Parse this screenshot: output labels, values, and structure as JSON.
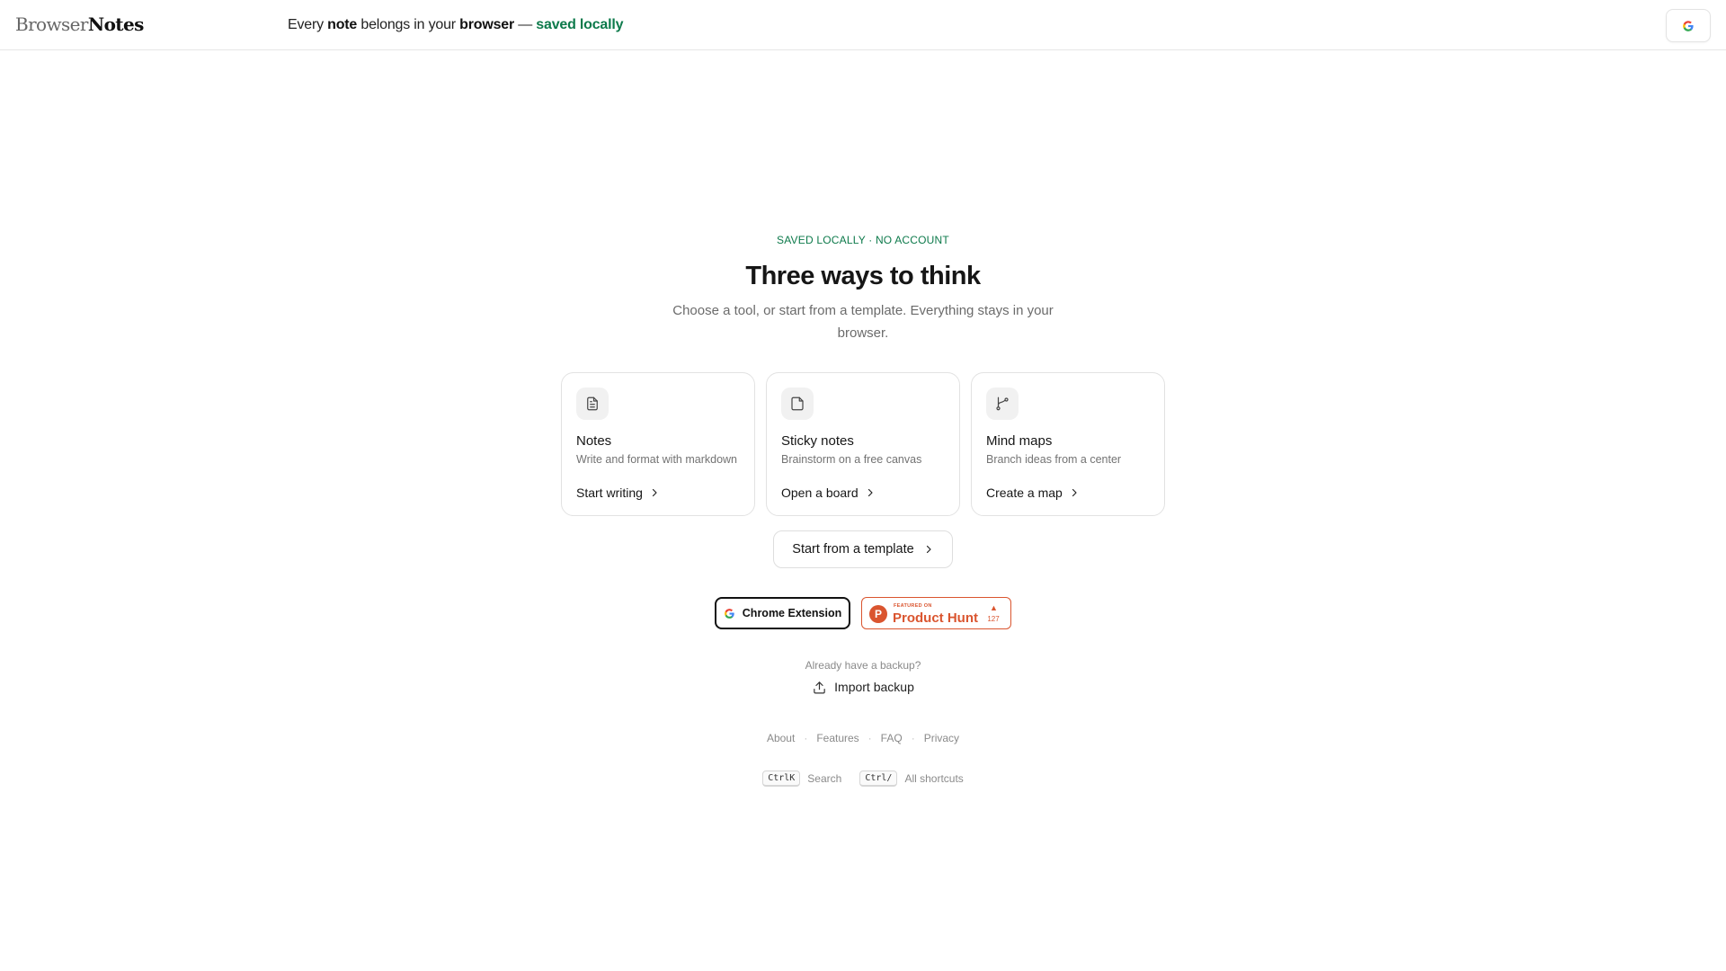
{
  "header": {
    "logo_light": "Browser",
    "logo_bold": "Notes",
    "tagline": {
      "t1": "Every ",
      "b1": "note",
      "t2": " belongs in your ",
      "b2": "browser",
      "t3": " — ",
      "green": "saved locally"
    },
    "google_icon": "google-g-icon"
  },
  "hero": {
    "eyebrow": "SAVED LOCALLY · NO ACCOUNT",
    "title": "Three ways to think",
    "subtitle": "Choose a tool, or start from a template. Everything stays in your browser."
  },
  "cards": [
    {
      "icon": "document-icon",
      "title": "Notes",
      "desc": "Write and format with markdown",
      "action": "Start writing"
    },
    {
      "icon": "sticky-note-icon",
      "title": "Sticky notes",
      "desc": "Brainstorm on a free canvas",
      "action": "Open a board"
    },
    {
      "icon": "branch-icon",
      "title": "Mind maps",
      "desc": "Branch ideas from a center",
      "action": "Create a map"
    }
  ],
  "template_button": "Start from a template",
  "badges": {
    "chrome": "Chrome Extension",
    "ph_small": "FEATURED ON",
    "ph_name": "Product Hunt",
    "ph_logo": "P",
    "ph_count": "127",
    "ph_color": "#da552f"
  },
  "import": {
    "question": "Already have a backup?",
    "button": "Import backup"
  },
  "footer": {
    "links": [
      "About",
      "Features",
      "FAQ",
      "Privacy"
    ],
    "shortcuts": [
      {
        "key": "CtrlK",
        "label": "Search"
      },
      {
        "key": "Ctrl/",
        "label": "All shortcuts"
      }
    ]
  },
  "colors": {
    "accent_green": "#0d7a4b",
    "text": "#161616",
    "muted": "#737373"
  }
}
